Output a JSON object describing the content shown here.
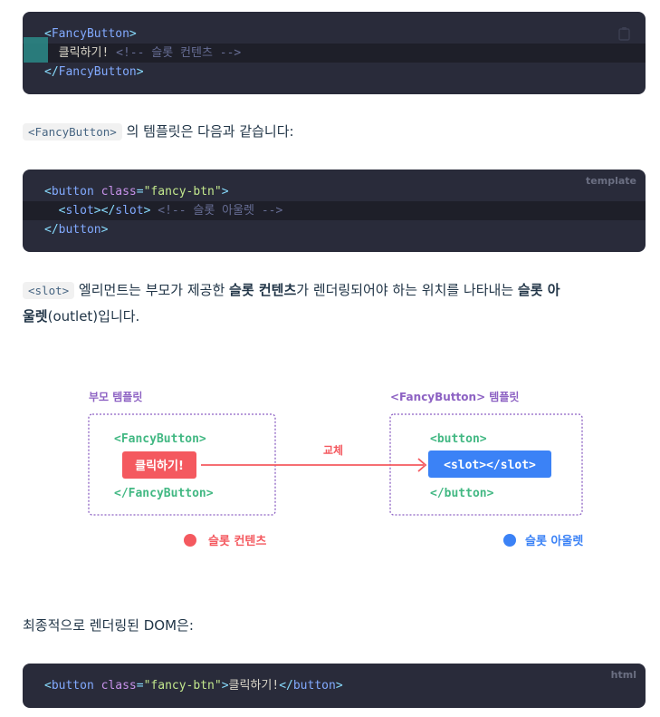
{
  "block1": {
    "lines": [
      {
        "open": "<",
        "name": "FancyButton",
        "close": ">"
      },
      {
        "text": "  클릭하기!",
        "comment": " <!-- 슬롯 컨텐츠 -->"
      },
      {
        "open": "</",
        "name": "FancyButton",
        "close": ">"
      }
    ]
  },
  "para1": {
    "code": "<FancyButton>",
    "text": " 의 템플릿은 다음과 같습니다:"
  },
  "block2": {
    "lang": "template",
    "line1": {
      "open": "<",
      "name": "button",
      "attr": "class",
      "eq": "=",
      "value": "\"fancy-btn\"",
      "close": ">"
    },
    "line2": {
      "indent": "  ",
      "open1": "<",
      "name1": "slot",
      "mid": "></",
      "name2": "slot",
      "close": ">",
      "comment": " <!-- 슬롯 아울렛 -->"
    },
    "line3": {
      "open": "</",
      "name": "button",
      "close": ">"
    }
  },
  "para2": {
    "code": "<slot>",
    "t1": " 엘리먼트는 부모가 제공한 ",
    "b1": "슬롯 컨텐츠",
    "t2": "가 렌더링되어야 하는 위치를 나타내는 ",
    "b2": "슬롯 아",
    "line2_b": "울렛",
    "line2_t": "(outlet)입니다."
  },
  "diagram": {
    "left_title": "부모 템플릿",
    "right_title": "<FancyButton> 템플릿",
    "left_open": "<FancyButton>",
    "left_content": "클릭하기!",
    "left_close": "</FancyButton>",
    "arrow_label": "교체",
    "right_open": "<button>",
    "right_slot": "<slot></slot>",
    "right_close": "</button>",
    "legend_content": "슬롯 컨텐츠",
    "legend_outlet": "슬롯 아울렛",
    "colors": {
      "purple": "#8d62c3",
      "green": "#42b883",
      "red": "#f4595f",
      "blue": "#3b82f6"
    }
  },
  "para3": {
    "text": "최종적으로 렌더링된 DOM은:"
  },
  "block3": {
    "lang": "html",
    "open": "<",
    "name": "button",
    "attr": "class",
    "eq": "=",
    "value": "\"fancy-btn\"",
    "close": ">",
    "text": "클릭하기!",
    "end_open": "</",
    "end_name": "button",
    "end_close": ">"
  }
}
